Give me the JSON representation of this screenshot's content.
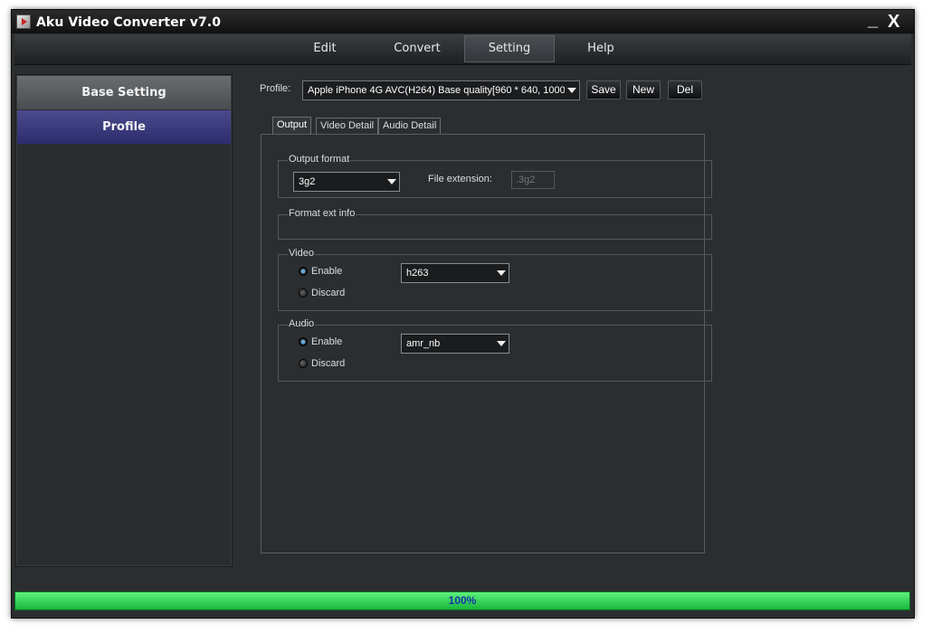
{
  "window": {
    "title": "Aku Video Converter v7.0",
    "minimize": "_",
    "close": "X"
  },
  "menu": {
    "items": [
      "Edit",
      "Convert",
      "Setting",
      "Help"
    ],
    "active": "Setting"
  },
  "sidebar": {
    "items": [
      "Base Setting",
      "Profile"
    ],
    "active": "Profile"
  },
  "profile": {
    "label": "Profile:",
    "selected": "Apple iPhone 4G AVC(H264) Base quality[960 * 640, 1000l",
    "buttons": {
      "save": "Save",
      "new": "New",
      "del": "Del"
    }
  },
  "tabs": {
    "items": [
      "Output",
      "Video Detail",
      "Audio Detail"
    ],
    "active": "Output"
  },
  "output": {
    "format_label": "Output format",
    "format_value": "3g2",
    "ext_label": "File extension:",
    "ext_value": ".3g2",
    "ext_info_label": "Format ext info"
  },
  "video": {
    "label": "Video",
    "enable": "Enable",
    "discard": "Discard",
    "codec": "h263",
    "selected": "Enable"
  },
  "audio": {
    "label": "Audio",
    "enable": "Enable",
    "discard": "Discard",
    "codec": "amr_nb",
    "selected": "Enable"
  },
  "progress": {
    "value_pct": 100,
    "text": "100%"
  },
  "colors": {
    "accent": "#2c2c6e",
    "progress": "#2ed150",
    "background": "#2b2e31"
  }
}
